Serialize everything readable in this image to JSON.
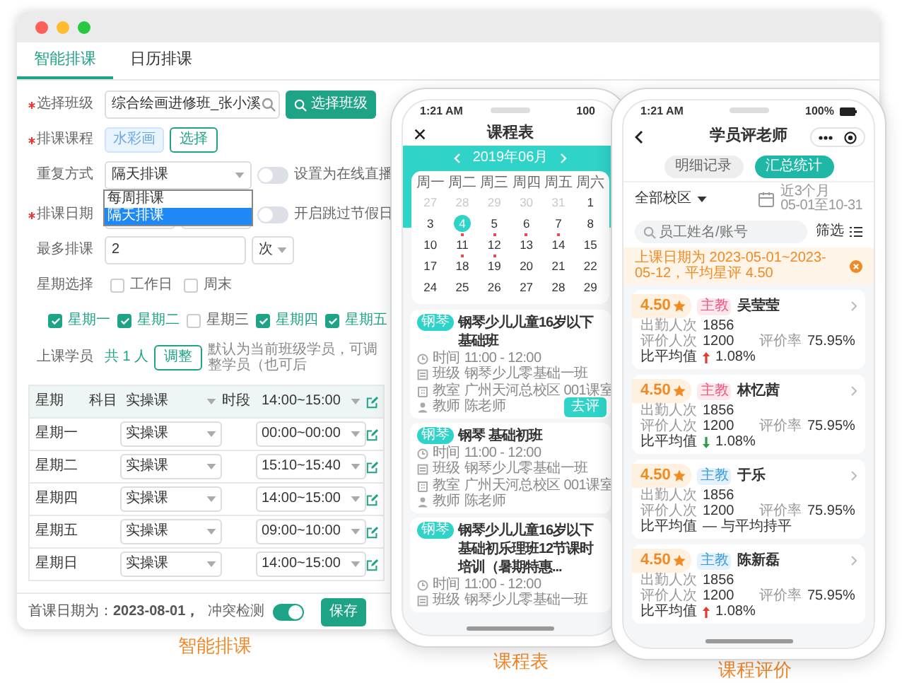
{
  "desktop": {
    "tabs": [
      {
        "label": "智能排课",
        "selected": true
      },
      {
        "label": "日历排课",
        "selected": false
      }
    ],
    "class_row": {
      "label": "选择班级",
      "required": true,
      "value": "综合绘画进修班_张小溪",
      "button": "选择班级"
    },
    "course_row": {
      "label": "排课课程",
      "required": true,
      "tag": "水彩画",
      "button": "选择"
    },
    "repeat_row": {
      "label": "重复方式",
      "value": "隔天排课",
      "options": [
        {
          "label": "每周排课",
          "selected": false
        },
        {
          "label": "隔天排课",
          "selected": true
        }
      ],
      "toggle": {
        "label": "设置为在线直播",
        "on": false
      }
    },
    "date_row": {
      "label": "排课日期",
      "required": true,
      "toggle": {
        "label": "开启跳过节假日",
        "on": false
      }
    },
    "max_row": {
      "label": "最多排课",
      "value": "2",
      "unit": "次"
    },
    "week_row": {
      "label": "星期选择",
      "presets": [
        {
          "label": "工作日",
          "checked": false
        },
        {
          "label": "周末",
          "checked": false
        }
      ],
      "days": [
        {
          "label": "星期一",
          "checked": true
        },
        {
          "label": "星期二",
          "checked": true
        },
        {
          "label": "星期三",
          "checked": false
        },
        {
          "label": "星期四",
          "checked": true
        },
        {
          "label": "星期五",
          "checked": true
        }
      ]
    },
    "students_row": {
      "label": "上课学员",
      "count": "共 1 人",
      "button": "调整",
      "hint": "默认为当前班级学员，可调整学员（也可后"
    },
    "table": {
      "columns": [
        "星期",
        "科目",
        "时段"
      ],
      "subject_all": "实操课",
      "time_all": "14:00~15:00",
      "rows": [
        {
          "day": "星期一",
          "subject": "实操课",
          "time": "00:00~00:00"
        },
        {
          "day": "星期二",
          "subject": "实操课",
          "time": "15:10~15:40"
        },
        {
          "day": "星期四",
          "subject": "实操课",
          "time": "14:00~15:00"
        },
        {
          "day": "星期五",
          "subject": "实操课",
          "time": "09:00~10:00"
        },
        {
          "day": "星期日",
          "subject": "实操课",
          "time": "14:00~15:00"
        }
      ]
    },
    "footer": {
      "first_date": "首课日期为：**2023-08-01，**",
      "conflict": {
        "label": "冲突检测",
        "on": true
      },
      "save": "保存"
    }
  },
  "schedule_phone": {
    "time": "1:21 AM",
    "battery": "100",
    "title": "课程表",
    "month": "2019年06月",
    "weekdays": [
      "周一",
      "周二",
      "周三",
      "周四",
      "周五",
      "周六"
    ],
    "weeks": [
      [
        {
          "day": "27",
          "muted": true,
          "selected": false,
          "has_class": false
        },
        {
          "day": "28",
          "muted": true,
          "selected": false,
          "has_class": false
        },
        {
          "day": "29",
          "muted": true,
          "selected": false,
          "has_class": false
        },
        {
          "day": "30",
          "muted": true,
          "selected": false,
          "has_class": false
        },
        {
          "day": "31",
          "muted": true,
          "selected": false,
          "has_class": false
        },
        {
          "day": "1",
          "muted": false,
          "selected": false,
          "has_class": false
        }
      ],
      [
        {
          "day": "3",
          "muted": false,
          "selected": false,
          "has_class": false
        },
        {
          "day": "4",
          "muted": false,
          "selected": true,
          "has_class": true
        },
        {
          "day": "5",
          "muted": false,
          "selected": false,
          "has_class": true
        },
        {
          "day": "6",
          "muted": false,
          "selected": false,
          "has_class": true
        },
        {
          "day": "7",
          "muted": false,
          "selected": false,
          "has_class": true
        },
        {
          "day": "8",
          "muted": false,
          "selected": false,
          "has_class": false
        }
      ],
      [
        {
          "day": "10",
          "muted": false,
          "selected": false,
          "has_class": false
        },
        {
          "day": "11",
          "muted": false,
          "selected": false,
          "has_class": true
        },
        {
          "day": "12",
          "muted": false,
          "selected": false,
          "has_class": true
        },
        {
          "day": "13",
          "muted": false,
          "selected": false,
          "has_class": false
        },
        {
          "day": "14",
          "muted": false,
          "selected": false,
          "has_class": false
        },
        {
          "day": "15",
          "muted": false,
          "selected": false,
          "has_class": false
        }
      ],
      [
        {
          "day": "17",
          "muted": false,
          "selected": false,
          "has_class": false
        },
        {
          "day": "18",
          "muted": false,
          "selected": false,
          "has_class": false
        },
        {
          "day": "19",
          "muted": false,
          "selected": false,
          "has_class": false
        },
        {
          "day": "20",
          "muted": false,
          "selected": false,
          "has_class": false
        },
        {
          "day": "21",
          "muted": false,
          "selected": false,
          "has_class": false
        },
        {
          "day": "22",
          "muted": false,
          "selected": false,
          "has_class": false
        }
      ],
      [
        {
          "day": "24",
          "muted": false,
          "selected": false,
          "has_class": false
        },
        {
          "day": "25",
          "muted": false,
          "selected": false,
          "has_class": false
        },
        {
          "day": "26",
          "muted": false,
          "selected": false,
          "has_class": false
        },
        {
          "day": "27",
          "muted": false,
          "selected": false,
          "has_class": false
        },
        {
          "day": "28",
          "muted": false,
          "selected": false,
          "has_class": false
        },
        {
          "day": "29",
          "muted": false,
          "selected": false,
          "has_class": false
        }
      ]
    ],
    "lessons": [
      {
        "tag": "钢琴",
        "title": "钢琴少儿儿童16岁以下基础班",
        "lines": [
          {
            "kind": "time",
            "label": "时间",
            "value": "11:00 - 12:00"
          },
          {
            "kind": "class",
            "label": "班级",
            "value": "钢琴少儿零基础一班"
          },
          {
            "kind": "room",
            "label": "教室",
            "value": "广州天河总校区 001课室"
          },
          {
            "kind": "teacher",
            "label": "教师",
            "value": "陈老师"
          }
        ],
        "button": "去评"
      },
      {
        "tag": "钢琴",
        "title": "钢琴 基础初班",
        "lines": [
          {
            "kind": "time",
            "label": "时间",
            "value": "11:00 - 12:00"
          },
          {
            "kind": "class",
            "label": "班级",
            "value": "钢琴少儿零基础一班"
          },
          {
            "kind": "room",
            "label": "教室",
            "value": "广州天河总校区 001课室"
          },
          {
            "kind": "teacher",
            "label": "教师",
            "value": "陈老师"
          }
        ]
      },
      {
        "tag": "钢琴",
        "title": "钢琴少儿儿童16岁以下基础初乐理班12节课时培训（暑期特惠...",
        "lines": [
          {
            "kind": "time",
            "label": "时间",
            "value": "11:00 - 12:00"
          },
          {
            "kind": "class",
            "label": "班级",
            "value": "钢琴少儿零基础一班"
          }
        ]
      }
    ]
  },
  "review_phone": {
    "time": "1:21 AM",
    "battery": "100%",
    "title": "学员评老师",
    "tabs": [
      {
        "label": "明细记录",
        "selected": false
      },
      {
        "label": "汇总统计",
        "selected": true
      }
    ],
    "campus": "全部校区",
    "range_label": "近3个月",
    "range_dates": "05-01至10-31",
    "search_placeholder": "员工姓名/账号",
    "filter": "筛选",
    "notice": "上课日期为 2023-05-01~2023-05-12，平均星评 4.50",
    "teachers": [
      {
        "rating": "4.50",
        "tag": "主教",
        "color": "#f2557f",
        "name": "吴莹莹",
        "attend_label": "出勤人次",
        "attend": "1856",
        "rated_label": "评价人次",
        "rated": "1200",
        "rate_label": "评价率",
        "rate": "75.95%",
        "compare_label": "比平均值",
        "kind": "up",
        "compare": "1.08%"
      },
      {
        "rating": "4.50",
        "tag": "主教",
        "color": "#f2557f",
        "name": "林忆茜",
        "attend_label": "出勤人次",
        "attend": "1856",
        "rated_label": "评价人次",
        "rated": "1200",
        "rate_label": "评价率",
        "rate": "75.95%",
        "compare_label": "比平均值",
        "kind": "down",
        "compare": "1.08%"
      },
      {
        "rating": "4.50",
        "tag": "主教",
        "color": "#3a9be0",
        "name": "于乐",
        "attend_label": "出勤人次",
        "attend": "1856",
        "rated_label": "评价人次",
        "rated": "1200",
        "rate_label": "评价率",
        "rate": "75.95%",
        "compare_label": "比平均值",
        "kind": "flat",
        "compare": "— 与平均持平"
      },
      {
        "rating": "4.50",
        "tag": "主教",
        "color": "#3a9be0",
        "name": "陈新磊",
        "attend_label": "出勤人次",
        "attend": "1856",
        "rated_label": "评价人次",
        "rated": "1200",
        "rate_label": "评价率",
        "rate": "75.95%",
        "compare_label": "比平均值",
        "kind": "up",
        "compare": "1.08%"
      }
    ]
  },
  "captions": [
    "智能排课",
    "课程表",
    "课程评价"
  ]
}
